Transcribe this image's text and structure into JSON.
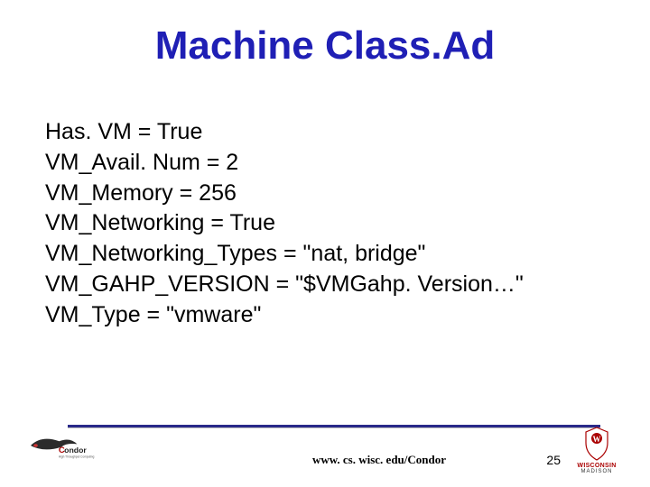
{
  "title": "Machine Class.Ad",
  "lines": [
    "Has. VM = True",
    "VM_Avail. Num = 2",
    "VM_Memory = 256",
    "VM_Networking = True",
    "VM_Networking_Types = \"nat, bridge\"",
    "VM_GAHP_VERSION = \"$VMGahp. Version…\"",
    "VM_Type = \"vmware\""
  ],
  "footer": {
    "url": "www. cs. wisc. edu/Condor",
    "page": "25",
    "uw_name": "WISCONSIN",
    "uw_sub": "MADISON"
  }
}
